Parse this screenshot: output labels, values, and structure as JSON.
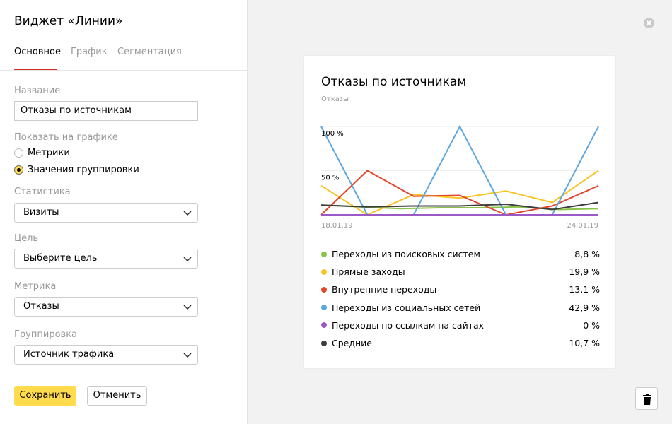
{
  "panel": {
    "title": "Виджет «Линии»",
    "tabs": [
      "Основное",
      "График",
      "Сегментация"
    ],
    "name_label": "Название",
    "name_value": "Отказы по источникам",
    "show_label": "Показать на графике",
    "radio_metrics": "Метрики",
    "radio_grouping": "Значения группировки",
    "selected_radio": "grouping",
    "stat_label": "Статистика",
    "stat_value": "Визиты",
    "goal_label": "Цель",
    "goal_value": "Выберите цель",
    "metric_label": "Метрика",
    "metric_value": "Отказы",
    "group_label": "Группировка",
    "group_value": "Источник трафика",
    "save_label": "Сохранить",
    "cancel_label": "Отменить"
  },
  "icons": {
    "close": "close-icon",
    "trash": "trash-icon",
    "chevron": "chevron-down-icon"
  },
  "colors": {
    "accent": "#ffdb4d",
    "tab_underline": "#d42a2a"
  },
  "card": {
    "title": "Отказы по источникам",
    "subtitle": "Отказы"
  },
  "chart_data": {
    "type": "line",
    "ylabel": "Отказы",
    "ytick_labels": [
      "100 %",
      "50 %"
    ],
    "x_start_label": "18.01.19",
    "x_end_label": "24.01.19",
    "ylim": [
      0,
      100
    ],
    "series": [
      {
        "name": "Переходы из поисковых систем",
        "color": "#8bc34a",
        "value": "8,8 %",
        "values": [
          11,
          9,
          7,
          8,
          8,
          9,
          6,
          7
        ]
      },
      {
        "name": "Прямые заходы",
        "color": "#f7c325",
        "value": "19,9 %",
        "values": [
          33,
          0,
          23,
          19,
          27,
          14,
          50
        ]
      },
      {
        "name": "Внутренние переходы",
        "color": "#e2462b",
        "value": "13,1 %",
        "values": [
          0,
          50,
          21,
          22,
          0,
          10,
          33
        ]
      },
      {
        "name": "Переходы из социальных сетей",
        "color": "#5ea7dd",
        "value": "42,9 %",
        "values": [
          100,
          0,
          0,
          100,
          0,
          0,
          100
        ]
      },
      {
        "name": "Переходы по ссылкам на сайтах",
        "color": "#9b59c5",
        "value": "0 %",
        "values": [
          0,
          0,
          0,
          0,
          0,
          0,
          0
        ]
      },
      {
        "name": "Средние",
        "color": "#3d3d3d",
        "value": "10,7 %",
        "values": [
          11,
          9,
          10,
          10,
          12,
          6,
          14
        ]
      }
    ]
  }
}
